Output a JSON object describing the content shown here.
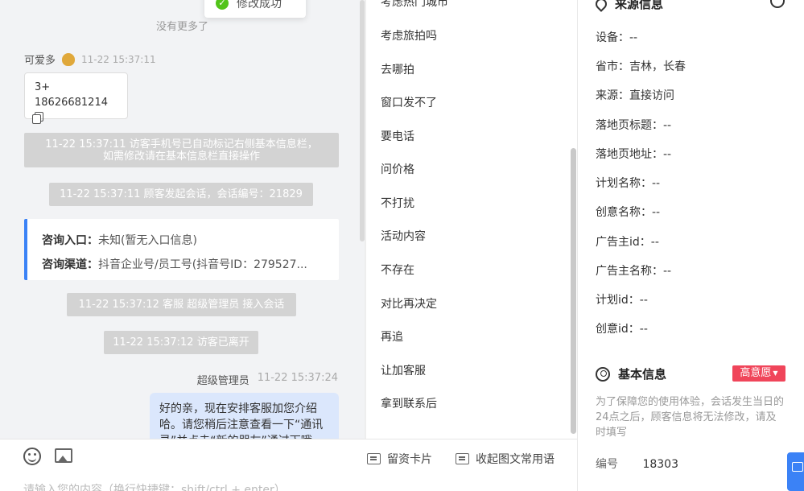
{
  "toast": {
    "text": "修改成功"
  },
  "chat": {
    "no_more": "没有更多了",
    "visitor": {
      "name": "可爱多",
      "time": "11-22 15:37:11"
    },
    "card": {
      "line1": "3+",
      "line2": "18626681214"
    },
    "sys1_line1": "11-22 15:37:11 访客手机号已自动标记右侧基本信息栏，",
    "sys1_line2": "如需修改请在基本信息栏直接操作",
    "sys2": "11-22 15:37:11 顾客发起会话，会话编号：21829",
    "entry_label": "咨询入口：",
    "entry_value": "未知(暂无入口信息)",
    "channel_label": "咨询渠道：",
    "channel_value": "抖音企业号/员工号(抖音号ID：279527...",
    "sys3": "11-22 15:37:12 客服 超级管理员 接入会话",
    "sys4": "11-22 15:37:12 访客已离开",
    "agent": {
      "name": "超级管理员",
      "time": "11-22 15:37:24"
    },
    "agent_msg": "好的亲，现在安排客服加您介绍哈。请您稍后注意查看一下“通讯录”并点击“新的朋友”通过下哦"
  },
  "input": {
    "card_btn": "留资卡片",
    "phrase_btn": "收起图文常用语",
    "placeholder": "请输入您的内容（换行快捷键：shift/ctrl + enter）"
  },
  "phrases": [
    "考虑热门城市",
    "考虑旅拍吗",
    "去哪拍",
    "窗口发不了",
    "要电话",
    "问价格",
    "不打扰",
    "活动内容",
    "不存在",
    "对比再决定",
    "再追",
    "让加客服",
    "拿到联系后"
  ],
  "source": {
    "title": "来源信息",
    "fields": [
      {
        "label": "设备：",
        "value": "--"
      },
      {
        "label": "省市：",
        "value": "吉林，长春"
      },
      {
        "label": "来源：",
        "value": "直接访问"
      },
      {
        "label": "落地页标题：",
        "value": "--"
      },
      {
        "label": "落地页地址：",
        "value": "--"
      },
      {
        "label": "计划名称：",
        "value": "--"
      },
      {
        "label": "创意名称：",
        "value": "--"
      },
      {
        "label": "广告主id：",
        "value": "--"
      },
      {
        "label": "广告主名称：",
        "value": "--"
      },
      {
        "label": "计划id：",
        "value": "--"
      },
      {
        "label": "创意id：",
        "value": "--"
      }
    ]
  },
  "basic": {
    "title": "基本信息",
    "badge": "高意愿",
    "notice": "为了保障您的使用体验，会话发生当日的24点之后，顾客信息将无法修改，请及时填写",
    "number_label": "编号",
    "number_value": "18303"
  },
  "colors": {
    "accent": "#3b82f6",
    "badge": "#f0455a",
    "success": "#52c41a"
  }
}
